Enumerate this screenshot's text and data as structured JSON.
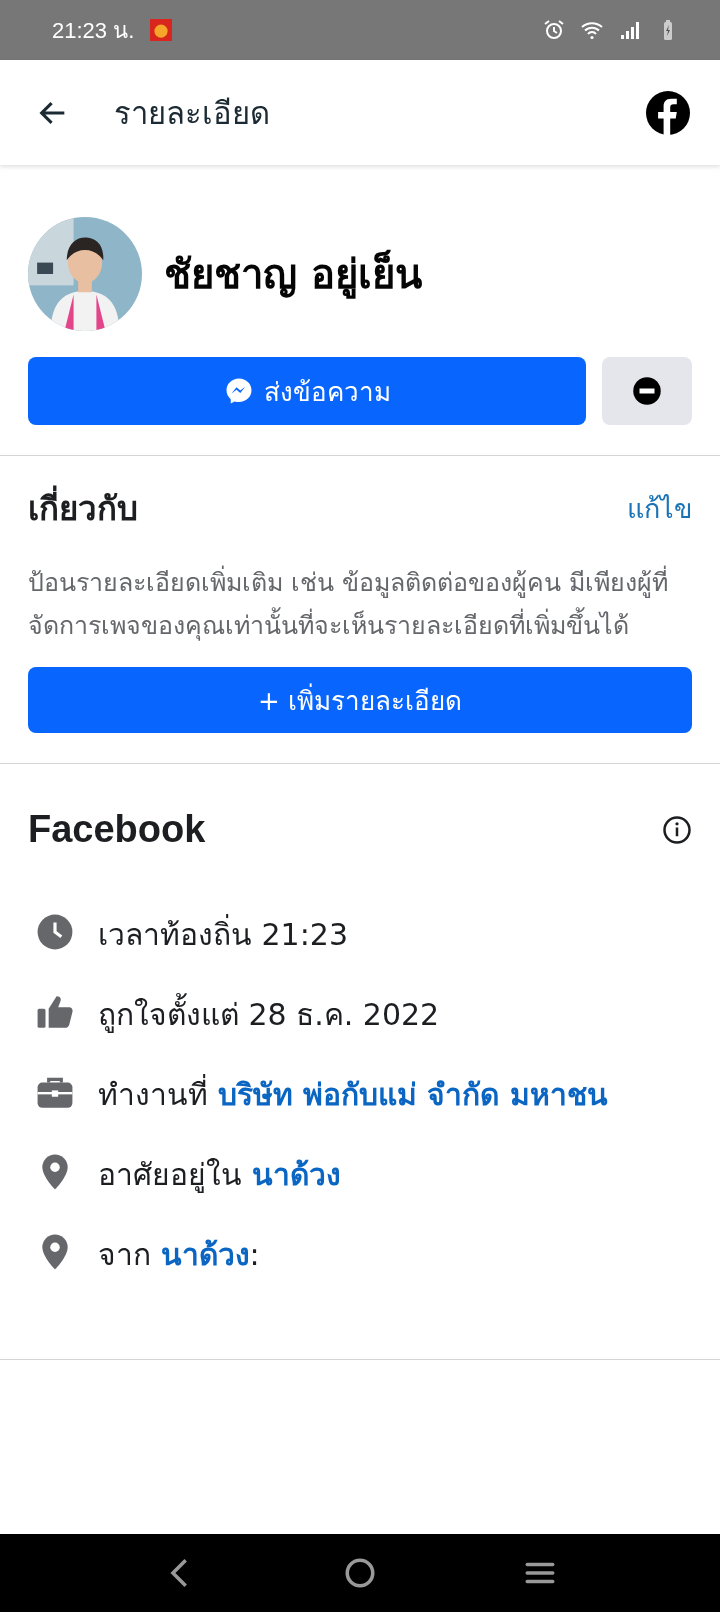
{
  "status_bar": {
    "time": "21:23 น."
  },
  "header": {
    "title": "รายละเอียด"
  },
  "profile": {
    "name": "ชัยชาญ อยู่เย็น",
    "message_button": "ส่งข้อความ"
  },
  "about": {
    "title": "เกี่ยวกับ",
    "edit_link": "แก้ไข",
    "description": "ป้อนรายละเอียดเพิ่มเติม เช่น ข้อมูลติดต่อของผู้คน มีเพียงผู้ที่จัดการเพจของคุณเท่านั้นที่จะเห็นรายละเอียดที่เพิ่มขึ้นได้",
    "add_button": "+ เพิ่มรายละเอียด"
  },
  "facebook": {
    "title": "Facebook",
    "items": [
      {
        "kind": "time",
        "text": "เวลาท้องถิ่น 21:23"
      },
      {
        "kind": "like",
        "text": "ถูกใจตั้งแต่ 28 ธ.ค. 2022"
      },
      {
        "kind": "work",
        "text": "ทำงานที่ ",
        "link": "บริษัท พ่อกับแม่ จำกัด มหาชน"
      },
      {
        "kind": "location",
        "text": "อาศัยอยู่ใน ",
        "link": "นาด้วง"
      },
      {
        "kind": "location",
        "text": "จาก ",
        "link": "นาด้วง",
        "suffix": ":"
      }
    ]
  }
}
